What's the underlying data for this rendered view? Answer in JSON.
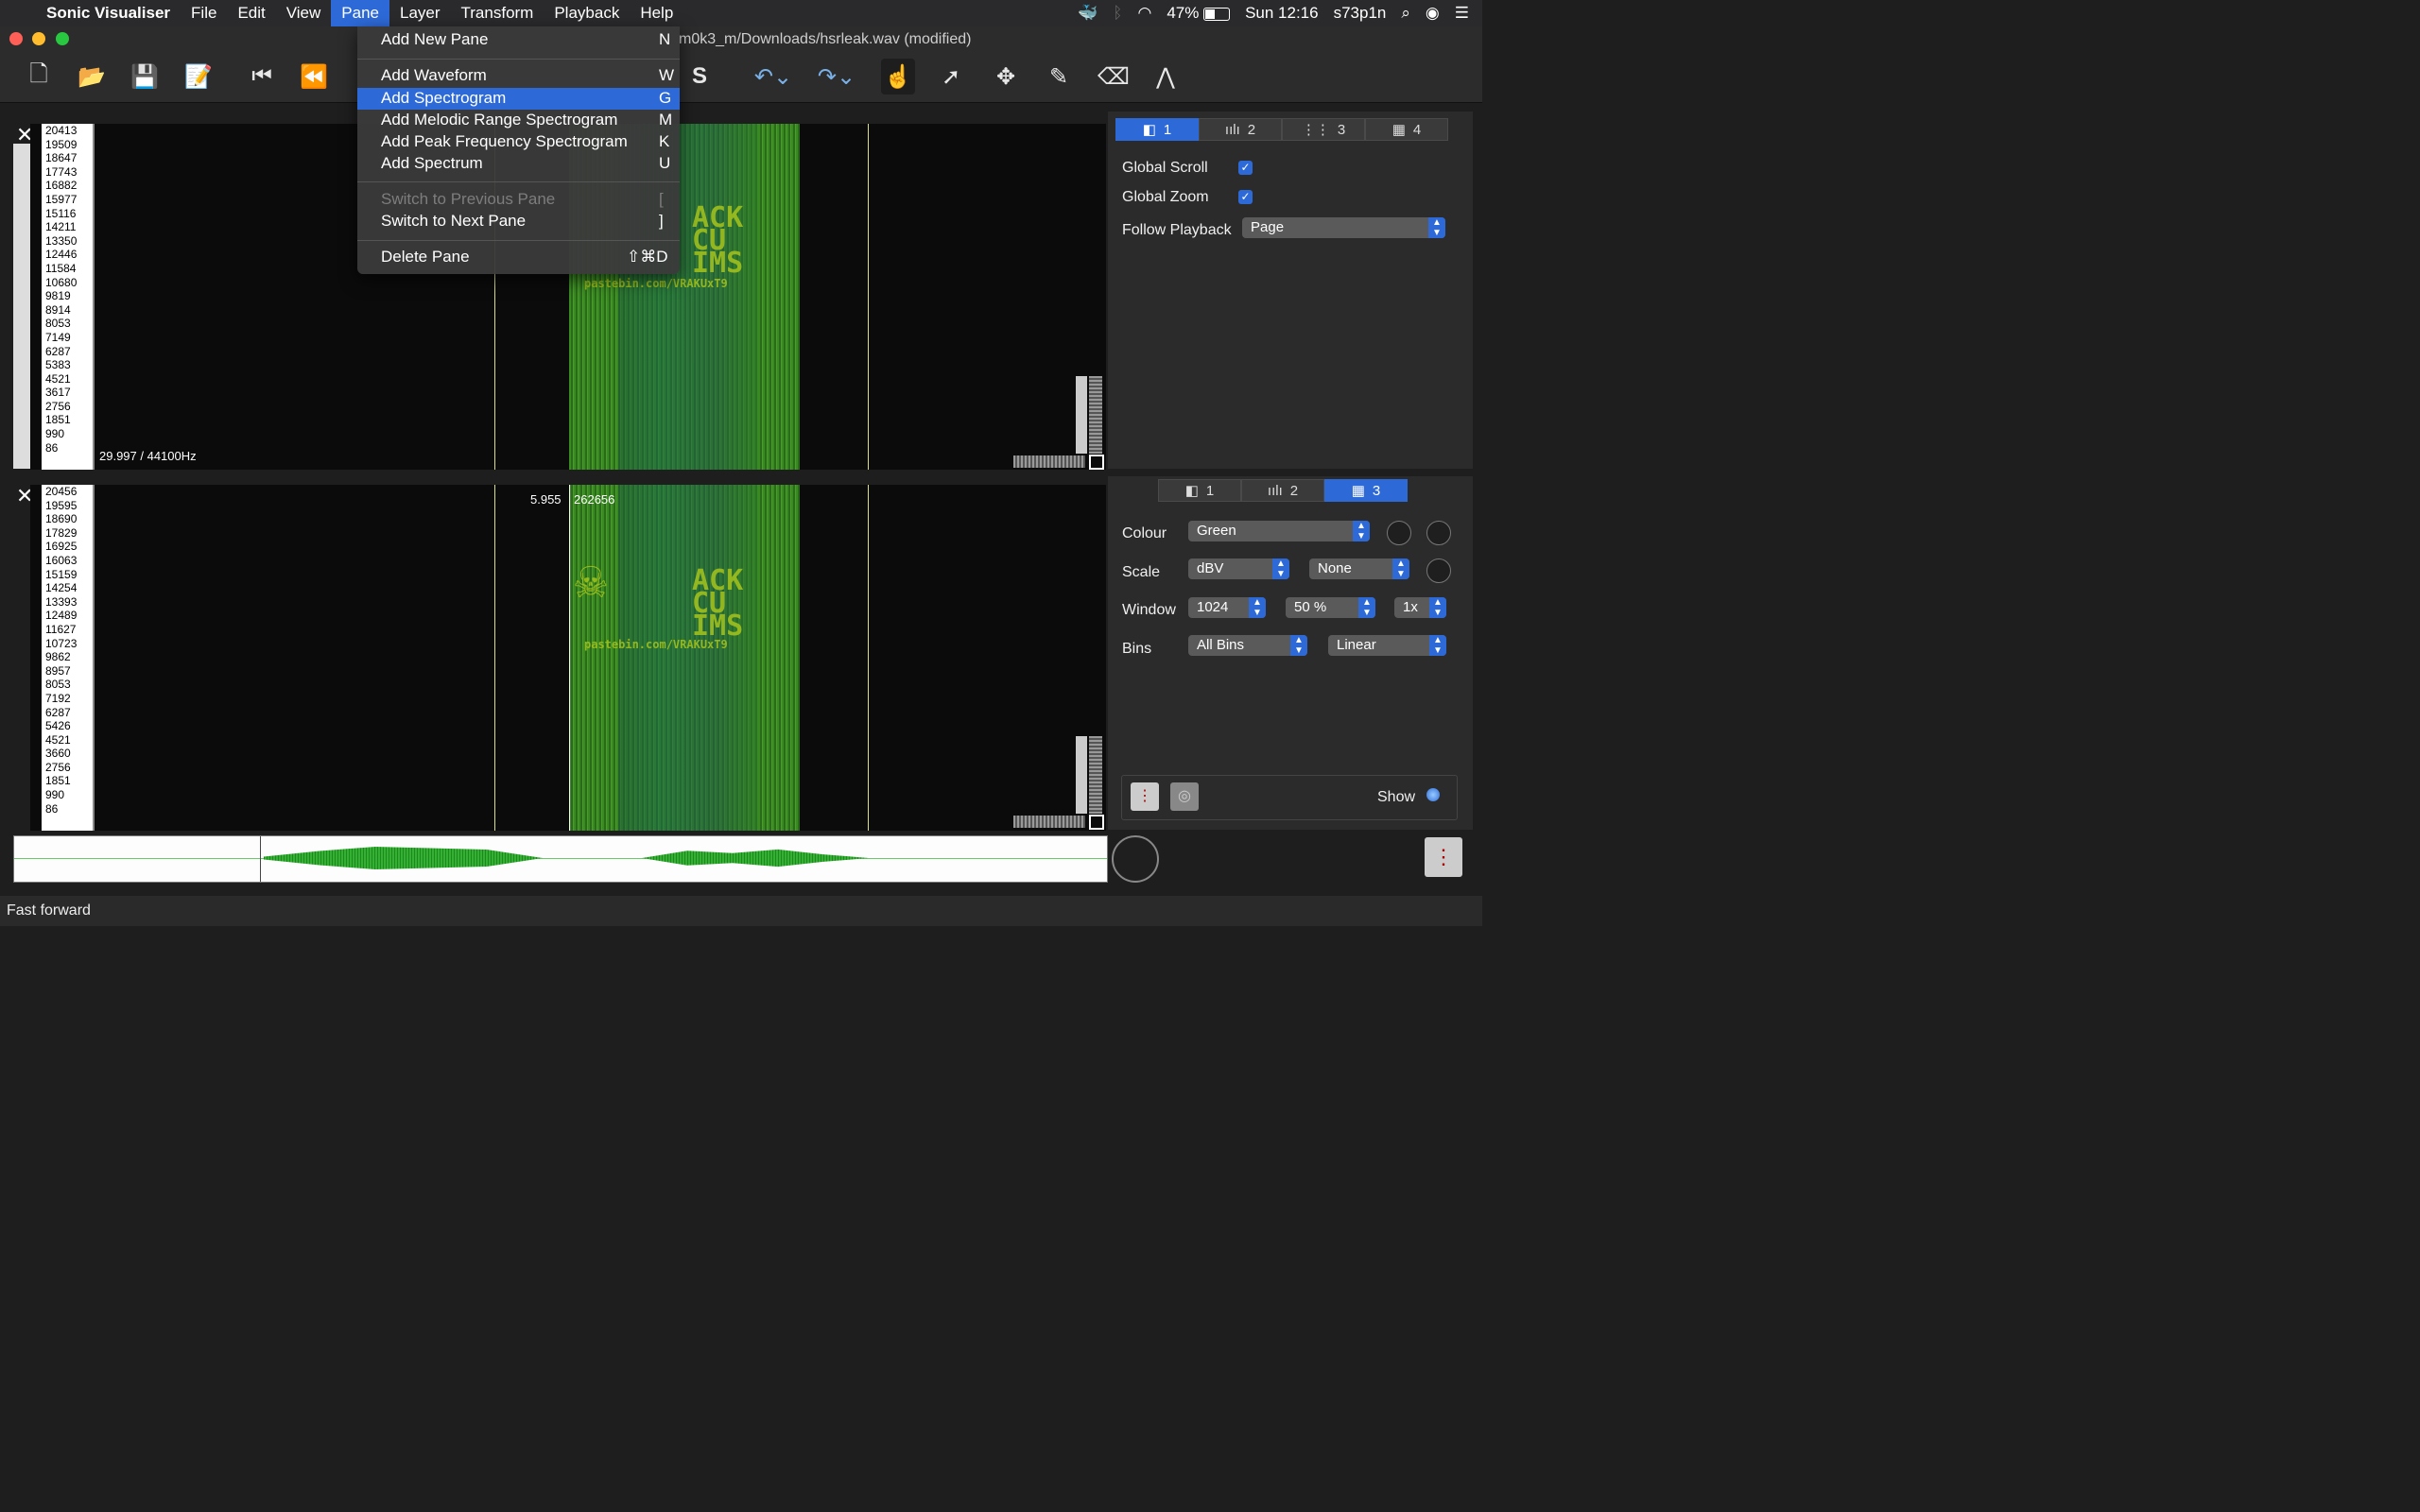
{
  "menubar": {
    "app_name": "Sonic Visualiser",
    "menus": [
      "File",
      "Edit",
      "View",
      "Pane",
      "Layer",
      "Transform",
      "Playback",
      "Help"
    ],
    "battery": "47%",
    "clock": "Sun 12:16",
    "user": "s73p1n"
  },
  "window": {
    "title": "m0k3_m/Downloads/hsrleak.wav (modified)"
  },
  "pane_menu": {
    "items": [
      {
        "label": "Add New Pane",
        "shortcut": "N"
      },
      {
        "label": "Add Waveform",
        "shortcut": "W"
      },
      {
        "label": "Add Spectrogram",
        "shortcut": "G"
      },
      {
        "label": "Add Melodic Range Spectrogram",
        "shortcut": "M"
      },
      {
        "label": "Add Peak Frequency Spectrogram",
        "shortcut": "K"
      },
      {
        "label": "Add Spectrum",
        "shortcut": "U"
      },
      {
        "label": "Switch to Previous Pane",
        "shortcut": "["
      },
      {
        "label": "Switch to Next Pane",
        "shortcut": "]"
      },
      {
        "label": "Delete Pane",
        "shortcut": "⇧⌘D"
      }
    ]
  },
  "pane1": {
    "scale": [
      "20413",
      "19509",
      "18647",
      "17743",
      "16882",
      "15977",
      "15116",
      "14211",
      "13350",
      "12446",
      "11584",
      "10680",
      "9819",
      "8914",
      "8053",
      "7149",
      "6287",
      "5383",
      "4521",
      "3617",
      "2756",
      "1851",
      "990",
      "86"
    ],
    "info": "29.997 / 44100Hz"
  },
  "pane2": {
    "scale": [
      "20456",
      "19595",
      "18690",
      "17829",
      "16925",
      "16063",
      "15159",
      "14254",
      "13393",
      "12489",
      "11627",
      "10723",
      "9862",
      "8957",
      "8053",
      "7192",
      "6287",
      "5426",
      "4521",
      "3660",
      "2756",
      "1851",
      "990",
      "86"
    ],
    "cursor_time": "5.955",
    "cursor_frame": "262656"
  },
  "watermark": {
    "lines": [
      "ACK",
      "CU",
      "IMS"
    ],
    "url": "pastebin.com/VRAKUxT9"
  },
  "panel1": {
    "tabs": [
      "1",
      "2",
      "3",
      "4"
    ],
    "global_scroll_label": "Global Scroll",
    "global_zoom_label": "Global Zoom",
    "follow_playback_label": "Follow Playback",
    "follow_playback_value": "Page"
  },
  "panel2": {
    "tabs": [
      "1",
      "2",
      "3"
    ],
    "colour_label": "Colour",
    "colour_value": "Green",
    "scale_label": "Scale",
    "scale_value": "dBV",
    "scale_norm": "None",
    "window_label": "Window",
    "window_size": "1024",
    "window_overlap": "50 %",
    "window_oversample": "1x",
    "bins_label": "Bins",
    "bins_value": "All Bins",
    "bins_scale": "Linear",
    "show_label": "Show"
  },
  "statusbar": {
    "text": "Fast forward"
  },
  "colors": {
    "accent": "#2d6ad8",
    "spectrum_green": "#3a8a22",
    "watermark_yellow": "#a6c41d"
  }
}
